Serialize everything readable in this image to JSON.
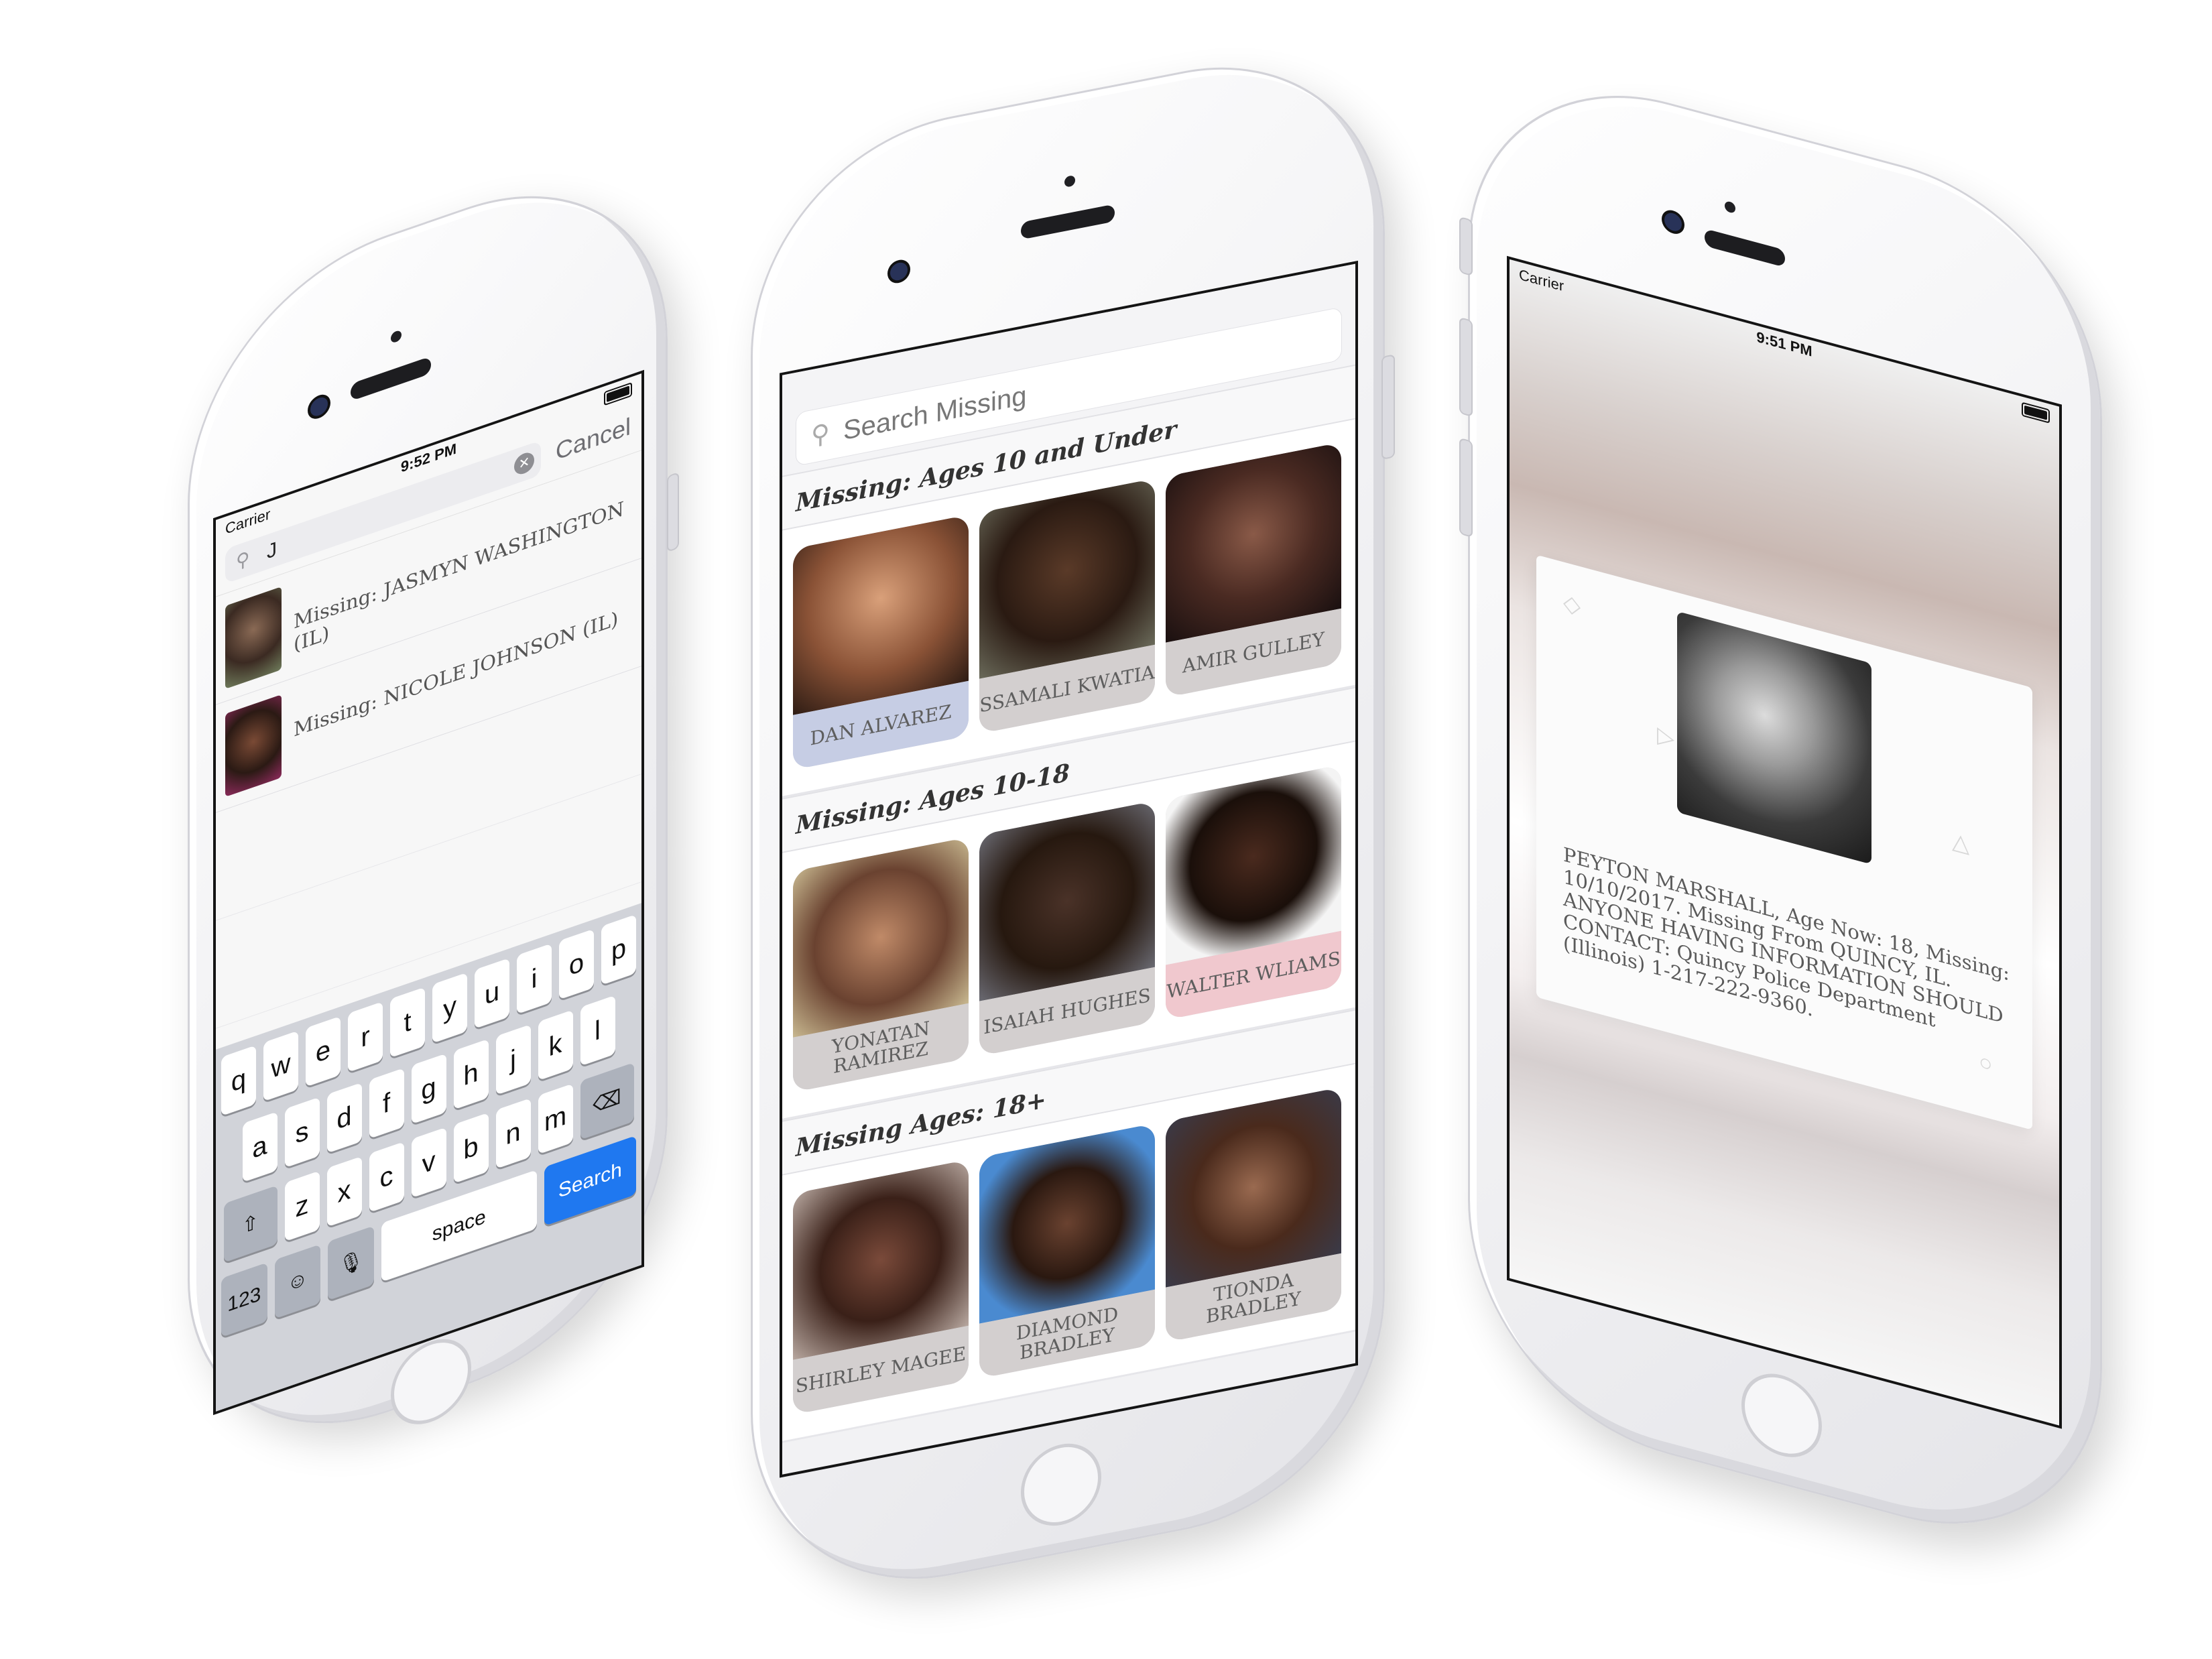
{
  "phone_search": {
    "status": {
      "carrier": "Carrier",
      "time": "9:52 PM"
    },
    "search": {
      "value": "J",
      "cancel": "Cancel"
    },
    "results": [
      {
        "label": "Missing: JASMYN WASHINGTON (IL)"
      },
      {
        "label": "Missing: NICOLE JOHNSON (IL)"
      }
    ],
    "keyboard": {
      "row1": [
        "q",
        "w",
        "e",
        "r",
        "t",
        "y",
        "u",
        "i",
        "o",
        "p"
      ],
      "row2": [
        "a",
        "s",
        "d",
        "f",
        "g",
        "h",
        "j",
        "k",
        "l"
      ],
      "row3": [
        "z",
        "x",
        "c",
        "v",
        "b",
        "n",
        "m"
      ],
      "numbers": "123",
      "space": "space",
      "search": "Search"
    }
  },
  "phone_browse": {
    "search_placeholder": "Search Missing",
    "sections": [
      {
        "title": "Missing: Ages 10 and Under",
        "cards": [
          "DAN ALVAREZ",
          "SSAMALI KWATIA",
          "AMIR GULLEY"
        ]
      },
      {
        "title": "Missing: Ages 10-18",
        "cards": [
          "YONATAN RAMIREZ",
          "ISAIAH HUGHES",
          "WALTER WLIAMS"
        ]
      },
      {
        "title": "Missing Ages: 18+",
        "cards": [
          "SHIRLEY MAGEE",
          "DIAMOND BRADLEY",
          "TIONDA BRADLEY"
        ]
      }
    ]
  },
  "phone_detail": {
    "status": {
      "carrier": "Carrier",
      "time": "9:51 PM"
    },
    "description": "PEYTON MARSHALL, Age Now: 18, Missing: 10/10/2017. Missing From QUINCY, IL. ANYONE HAVING INFORMATION SHOULD CONTACT: Quincy Police Department (Illinois) 1-217-222-9360."
  },
  "colors": {
    "accent": "#1f78f0",
    "keyboard_bg": "#d1d3d9",
    "card_label": "#d2cece",
    "card_label_pink": "#f0c8ce"
  }
}
